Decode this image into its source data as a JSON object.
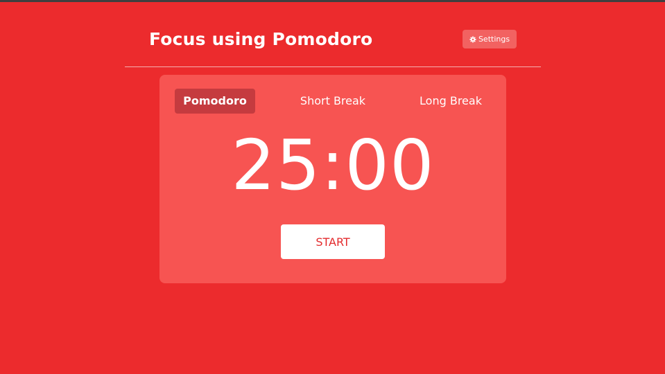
{
  "header": {
    "title": "Focus using Pomodoro",
    "settings_label": "Settings",
    "settings_icon": "gear-icon"
  },
  "tabs": [
    {
      "label": "Pomodoro",
      "active": true
    },
    {
      "label": "Short Break",
      "active": false
    },
    {
      "label": "Long Break",
      "active": false
    }
  ],
  "timer": {
    "display": "25:00"
  },
  "controls": {
    "start_label": "START"
  },
  "colors": {
    "background": "#ec2b2d",
    "card": "#f75452",
    "active_tab": "#c53b3f",
    "settings_button": "#f26261",
    "text": "#ffffff",
    "start_text": "#e32a2c"
  }
}
